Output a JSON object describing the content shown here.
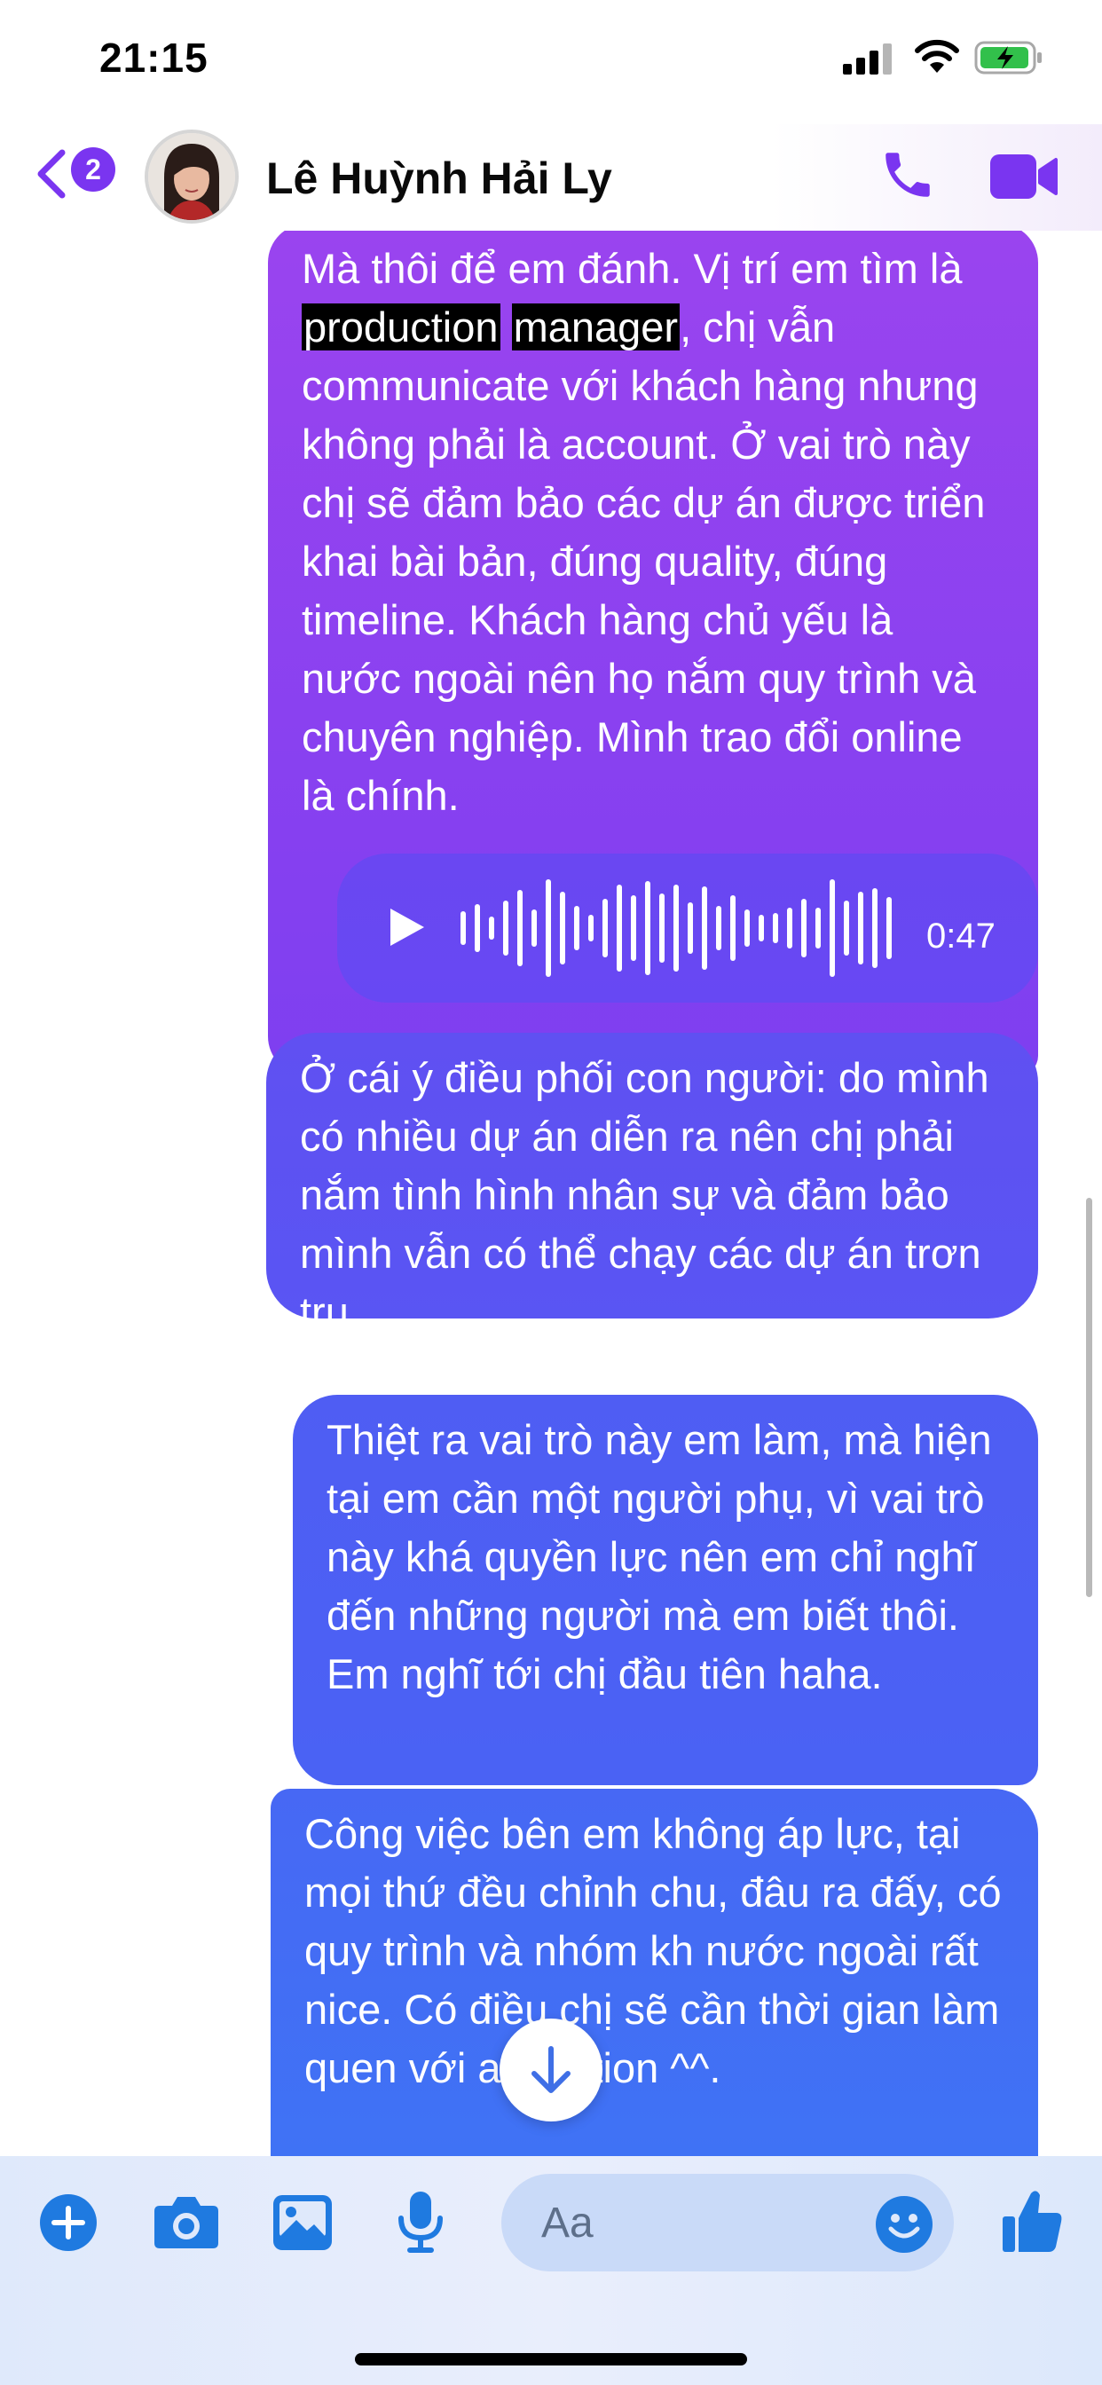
{
  "status_bar": {
    "time": "21:15"
  },
  "header": {
    "unread_count": "2",
    "contact_name": "Lê Huỳnh Hải Ly"
  },
  "messages": {
    "m1": {
      "part1": "Mà thôi để em đánh. Vị trí em tìm là ",
      "hl1": "production",
      "space": " ",
      "hl2": "manager",
      "part2": ", chị vẫn communicate với khách hàng nhưng không phải là account. Ở vai trò này chị sẽ đảm bảo các dự án được triển khai bài bản, đúng quality, đúng timeline. Khách hàng chủ yếu là nước ngoài nên họ nắm quy trình và chuyên nghiệp. Mình trao đổi online là chính."
    },
    "voice": {
      "duration": "0:47"
    },
    "m2": "Ở cái ý điều phối con người: do mình có nhiều dự án diễn ra nên chị phải nắm tình hình nhân sự và đảm bảo mình vẫn có thể chạy các dự án trơn tru.",
    "m3": "Thiệt ra vai trò này em làm, mà hiện tại em cần một người phụ, vì vai trò này khá quyền lực nên em chỉ nghĩ đến những người mà em biết thôi. Em nghĩ tới chị đầu tiên haha.",
    "m4": "Công việc bên em không áp lực, tại mọi thứ đều chỉnh chu, đâu ra đấy, có quy trình và nhóm kh nước ngoài rất nice. Có điều chị sẽ cần thời gian làm quen với animation ^^."
  },
  "composer": {
    "placeholder": "Aa"
  },
  "colors": {
    "accent": "#7a35f0",
    "composer_icon": "#1f7ae0"
  }
}
